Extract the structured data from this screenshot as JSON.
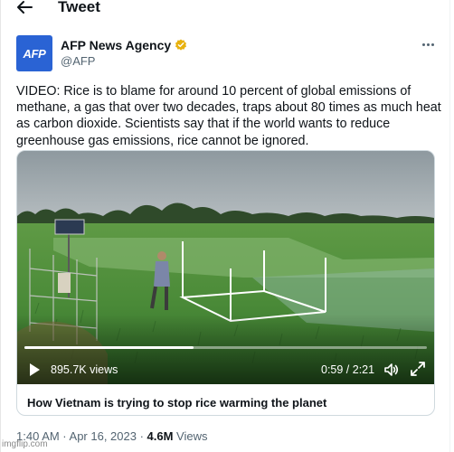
{
  "header": {
    "title": "Tweet"
  },
  "author": {
    "avatar_text": "AFP",
    "name": "AFP News Agency",
    "handle": "@AFP",
    "avatar_color": "#2a63d4",
    "verified_color": "#e8b10d"
  },
  "tweet": {
    "text": "VIDEO: Rice is to blame for around 10 percent of global emissions of methane, a gas that over two decades, traps about 80 times as much heat as carbon dioxide. Scientists say that if the world wants to reduce greenhouse gas emissions, rice cannot be ignored."
  },
  "media": {
    "views": "895.7K views",
    "time": "0:59 / 2:21",
    "progress": 0.42,
    "card_title": "How Vietnam is trying to stop rice warming the planet"
  },
  "meta": {
    "timestamp": "1:40 AM · Apr 16, 2023 · ",
    "views_count": "4.6M",
    "views_label": " Views"
  },
  "watermark": "imgflip.com",
  "icons": {
    "back": "arrow-left-icon",
    "more": "more-dots-icon",
    "verified": "verified-badge-icon",
    "play": "play-icon",
    "volume": "volume-icon",
    "fullscreen": "fullscreen-icon"
  }
}
